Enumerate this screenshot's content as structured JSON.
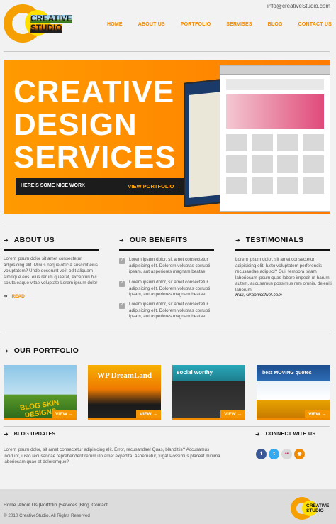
{
  "header": {
    "email": "info@creativeStudio.com",
    "logo_line1": "CREATIVE",
    "logo_line2": "STUDIO",
    "nav": [
      "HOME",
      "ABOUT US",
      "PORTFOLIO",
      "SERVISES",
      "BLOG",
      "CONTACT US"
    ]
  },
  "banner": {
    "line1": "CREATIVE",
    "line2": "DESIGN",
    "line3": "SERVICES",
    "tagline": "HERE'S SOME NICE WORK",
    "cta": "VIEW PORTFOLIO →"
  },
  "about": {
    "title": "ABOUT US",
    "text": "Lorem ipsum dolor sit amet consectetur adipisicing elit. Minus neque officia suscipit eius voluptatem? Unde deserunt velit odit aliquam similique eos, eius rerum quaerat, excepturi hic soluta eaque vitae voluptate Lorem ipsum dolor",
    "read": "READ"
  },
  "benefits": {
    "title": "OUR BENEFITS",
    "items": [
      "Lorem ipsum dolor, sit amet consectetur adipisicing elit. Dolorem voluptas corrupti ipsam, aut asperiores magnam beatae",
      "Lorem ipsum dolor, sit amet consectetur adipisicing elit. Dolorem voluptas corrupti ipsam, aut asperiores magnam beatae",
      "Lorem ipsum dolor, sit amet consectetur adipisicing elit. Dolorem voluptas corrupti ipsam, aut asperiores magnam beatae"
    ]
  },
  "testimonials": {
    "title": "TESTIMONIALS",
    "text": "Lorem ipsum dolor, sit amet consectetur adipisicing elit. Iusto voluptatem perferendis recusandae adipisci? Qui, tempora totam laboriosam ipsum quas labore impedit ut harum autem, accusamus possimus rem omnis, deleniti laborum.",
    "author": "Rafi, Graphicsfuel.com"
  },
  "portfolio": {
    "title": "OUR PORTFOLIO",
    "view": "VIEW →",
    "items": [
      {
        "caption": "BLOG SKIN DESIGNS"
      },
      {
        "caption": "WP DreamLand"
      },
      {
        "caption": "social worthy"
      },
      {
        "caption": "best MOVING quotes"
      }
    ]
  },
  "blog": {
    "title": "BLOG UPDATES",
    "text": "Lorem ipsum dolor, sit amet consectetur adipisicing elit. Error, recusandae! Quas, blanditiis? Accusamus incidunt, iusto recusandae reprehenderit rerum illo amet expedita. Aspernatur, fuga! Possimus placeat minima laboriosam quae et doloremque?"
  },
  "connect": {
    "title": "CONNECT WITH US",
    "icons": [
      {
        "name": "facebook",
        "label": "f",
        "color": "#3b5998"
      },
      {
        "name": "twitter",
        "label": "t",
        "color": "#33aaf0"
      },
      {
        "name": "flickr",
        "label": "••",
        "color": "#d9d9d9"
      },
      {
        "name": "rss",
        "label": "◉",
        "color": "#f08a00"
      }
    ]
  },
  "footer": {
    "links": [
      "Home",
      "About Us",
      "Portfolio",
      "Services",
      "Blog",
      "Contact"
    ],
    "copyright": "© 2010 CreativeStudio. All Rights Reserved",
    "logo_line1": "CREATIVE",
    "logo_line2": "STUDIO"
  },
  "colors": {
    "accent": "#f08a00",
    "banner": "#ff8a00",
    "logo_yellow": "#ffe000"
  }
}
